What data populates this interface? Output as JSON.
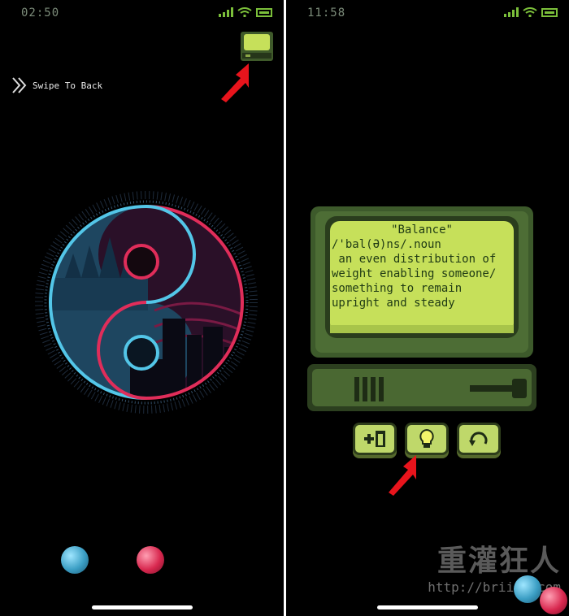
{
  "left": {
    "status": {
      "time": "02:50"
    },
    "swipe_back_label": "Swipe To Back",
    "colors": {
      "cyan": "#53c6e8",
      "red": "#e02d5a"
    }
  },
  "right": {
    "status": {
      "time": "11:58"
    },
    "definition": {
      "title": "\"Balance\"",
      "lines": [
        "/'bal(Ə)ns/.noun",
        " an even distribution of",
        "weight enabling someone/",
        "something to remain",
        "upright and steady"
      ]
    },
    "buttons": [
      {
        "icon": "add-icon"
      },
      {
        "icon": "lightbulb-icon"
      },
      {
        "icon": "refresh-icon"
      }
    ],
    "watermark": {
      "text": "重灌狂人",
      "url": "http://briian.com"
    }
  }
}
